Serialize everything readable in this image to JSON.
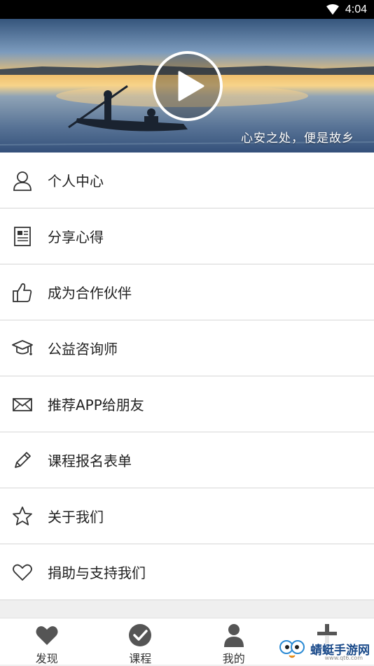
{
  "status": {
    "time": "4:04"
  },
  "banner": {
    "caption": "心安之处，便是故乡"
  },
  "menu": {
    "items": [
      {
        "label": "个人中心",
        "icon": "person-icon"
      },
      {
        "label": "分享心得",
        "icon": "document-icon"
      },
      {
        "label": "成为合作伙伴",
        "icon": "thumbs-up-icon"
      },
      {
        "label": "公益咨询师",
        "icon": "graduation-cap-icon"
      },
      {
        "label": "推荐APP给朋友",
        "icon": "mail-icon"
      },
      {
        "label": "课程报名表单",
        "icon": "pencil-icon"
      },
      {
        "label": "关于我们",
        "icon": "star-icon"
      },
      {
        "label": "捐助与支持我们",
        "icon": "heart-icon"
      }
    ]
  },
  "tabbar": {
    "tabs": [
      {
        "label": "发现",
        "icon": "heart-icon"
      },
      {
        "label": "课程",
        "icon": "check-circle-icon"
      },
      {
        "label": "我的",
        "icon": "person-icon"
      },
      {
        "label": "",
        "icon": "plus-icon"
      }
    ]
  },
  "watermark": {
    "text": "蜻蜓手游网",
    "url": "www.qt6.com"
  }
}
